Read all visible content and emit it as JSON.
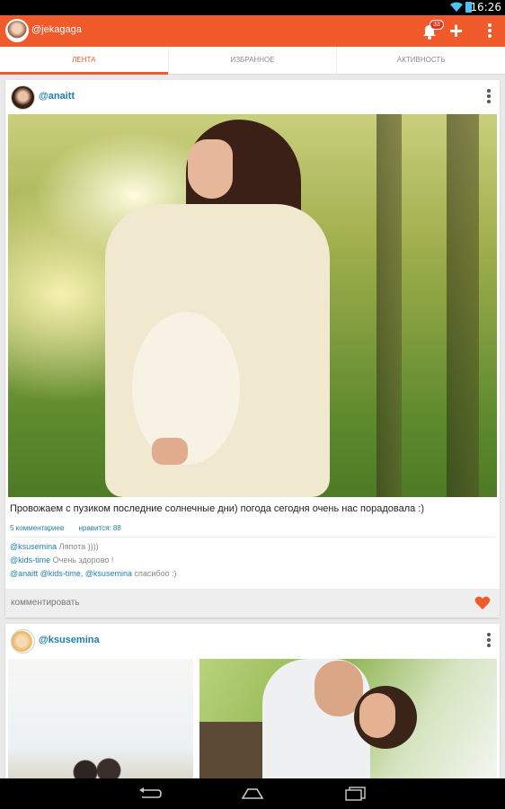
{
  "statusbar": {
    "time": "16:26"
  },
  "appbar": {
    "username": "@jekagaga",
    "notification_count": "33",
    "add_label": "+",
    "accent": "#f15a2b"
  },
  "tabs": [
    {
      "label": "ЛЕНТА",
      "active": true
    },
    {
      "label": "ИЗБРАННОЕ",
      "active": false
    },
    {
      "label": "АКТИВНОСТЬ",
      "active": false
    }
  ],
  "posts": [
    {
      "user": "@anaitt",
      "caption": "Провожаем с пузиком последние солнечные дни) погода сегодня очень нас порадовала :)",
      "comments_count": "5 комментариев",
      "likes": "нравится: 88",
      "comments": [
        {
          "user": "@ksusemina",
          "text": " Ляпота ))))"
        },
        {
          "user": "@kids-time",
          "text": " Очень здорово !"
        },
        {
          "user": "@anaitt",
          "text_tag": " @kids-time, @ksusemina",
          "text": " спасибоо :)"
        }
      ],
      "comment_button": "комментировать",
      "liked": true
    },
    {
      "user": "@ksusemina"
    }
  ]
}
